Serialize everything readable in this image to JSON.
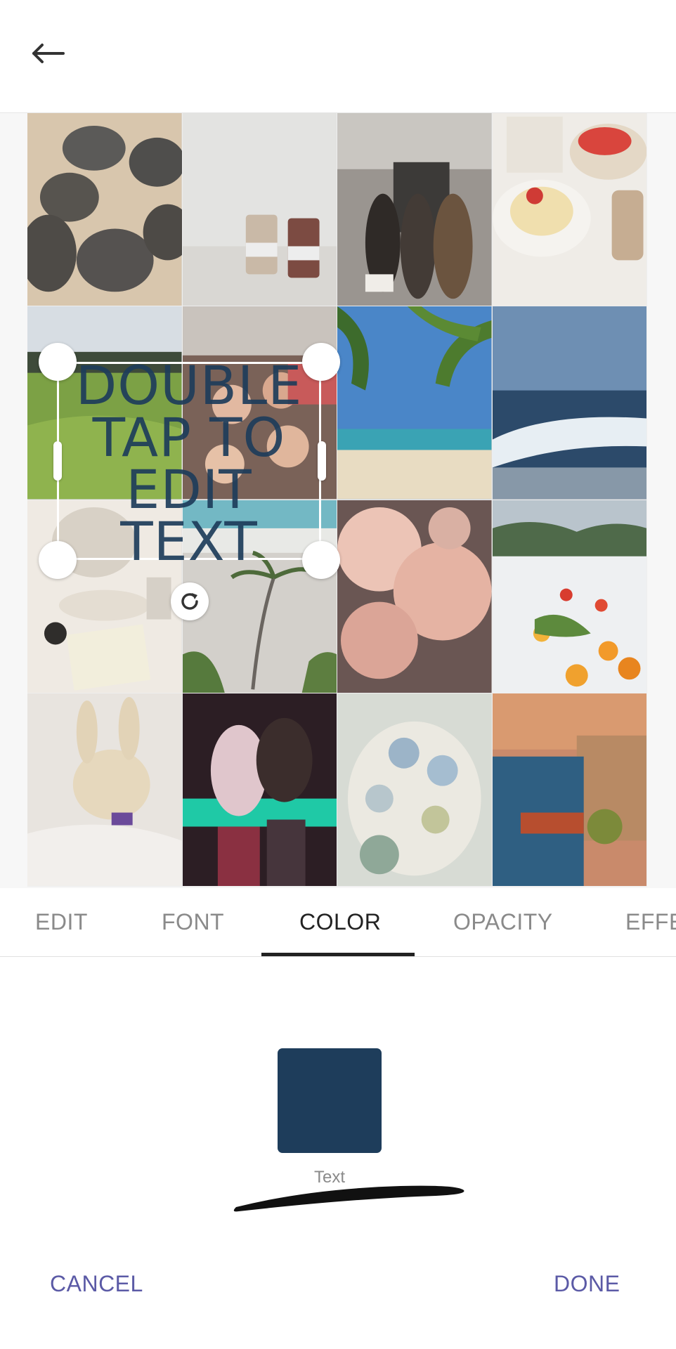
{
  "header": {
    "back_icon": "arrow-left-icon"
  },
  "canvas": {
    "overlay_text": "DOUBLE TAP TO EDIT TEXT",
    "text_color": "#1e3d5b",
    "rotate_icon": "rotate-icon"
  },
  "tabs": [
    {
      "label": "EDIT",
      "active": false
    },
    {
      "label": "FONT",
      "active": false
    },
    {
      "label": "COLOR",
      "active": true
    },
    {
      "label": "OPACITY",
      "active": false
    },
    {
      "label": "EFFE",
      "active": false
    }
  ],
  "color_panel": {
    "swatch_color": "#1e3d5b",
    "swatch_label": "Text"
  },
  "actions": {
    "cancel_label": "CANCEL",
    "done_label": "DONE",
    "accent_color": "#5b5aa6"
  }
}
